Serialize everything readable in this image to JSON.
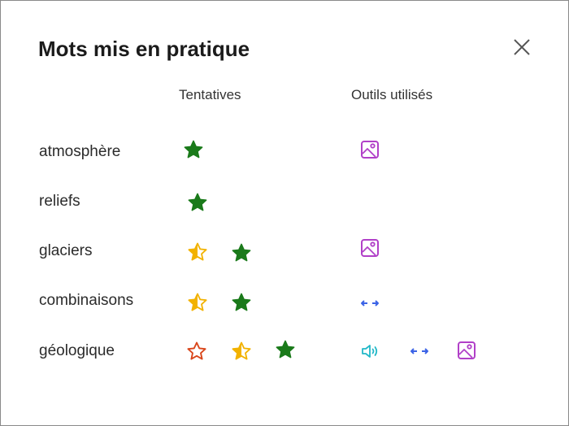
{
  "dialog": {
    "title": "Mots mis en pratique",
    "close_icon": "close-icon"
  },
  "headers": {
    "attempts": "Tentatives",
    "tools": "Outils utilisés"
  },
  "legend_icons": {
    "star_full": "star-filled-green-icon",
    "star_half": "star-half-yellow-icon",
    "star_empty": "star-outline-red-icon",
    "image_tool": "image-tool-icon",
    "word_split_tool": "syllables-split-icon",
    "read_aloud_tool": "speaker-icon"
  },
  "colors": {
    "green_star": "#1a7a1a",
    "yellow_star": "#f2b200",
    "red_star": "#d9461b",
    "image_tool": "#b140c8",
    "split_tool": "#3b63e6",
    "speaker_tool": "#22b8c8"
  },
  "words": [
    {
      "word": "atmosphère",
      "attempts": [
        "full"
      ],
      "tools": [
        "image"
      ]
    },
    {
      "word": "reliefs",
      "attempts": [
        "full"
      ],
      "tools": []
    },
    {
      "word": "glaciers",
      "attempts": [
        "half",
        "full"
      ],
      "tools": [
        "image"
      ]
    },
    {
      "word": "combinaisons",
      "attempts": [
        "half",
        "full"
      ],
      "tools": [
        "split"
      ]
    },
    {
      "word": "géologique",
      "attempts": [
        "empty",
        "half",
        "full"
      ],
      "tools": [
        "speaker",
        "split",
        "image"
      ]
    }
  ]
}
